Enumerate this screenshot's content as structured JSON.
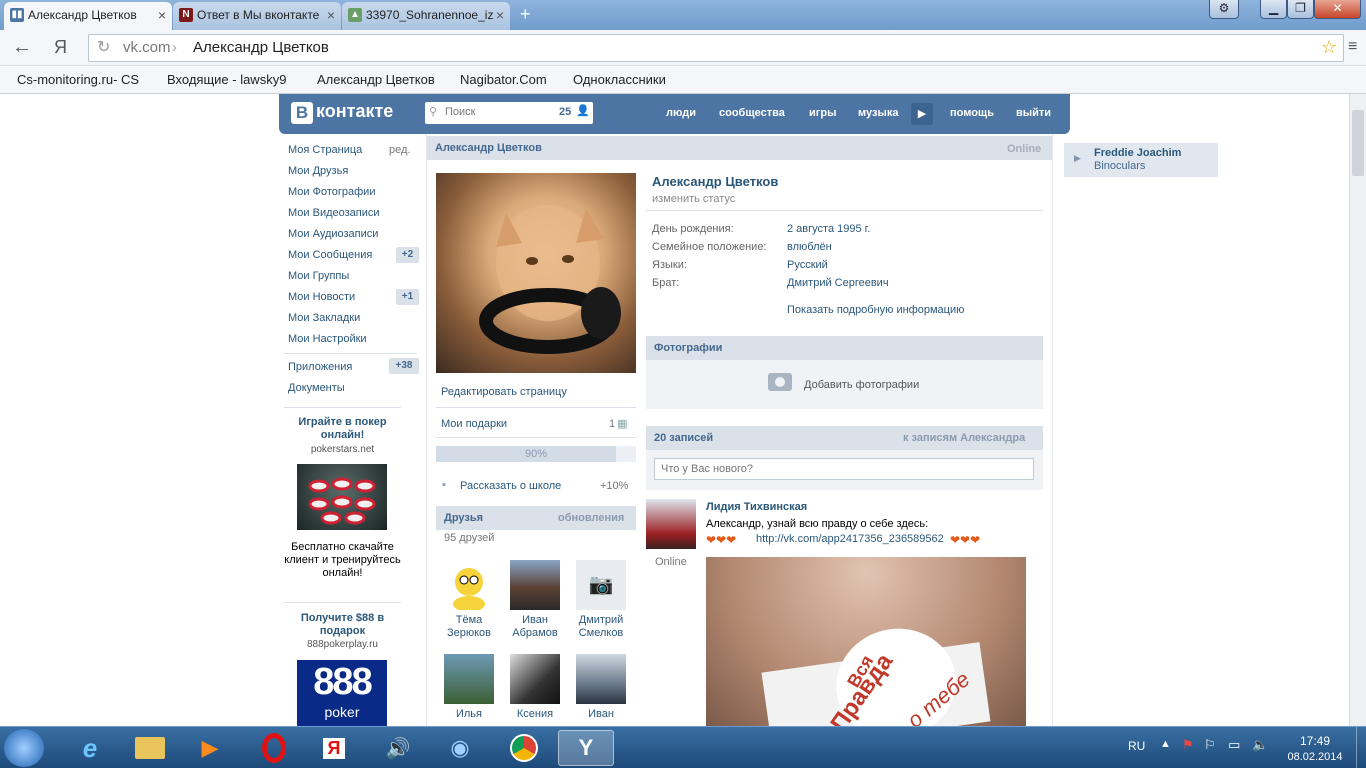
{
  "browser": {
    "tabs": [
      {
        "title": "Александр Цветков",
        "favicon": "vk-icon"
      },
      {
        "title": "Ответ в Мы вконтакте",
        "favicon": "n-icon"
      },
      {
        "title": "33970_Sohranennoe_iz",
        "favicon": "image-icon"
      }
    ],
    "address": {
      "domain": "vk.com",
      "sep": " / ",
      "path": "Александр Цветков"
    },
    "bookmarks": [
      "Cs-monitoring.ru- CS",
      "Входящие - lawsky9",
      "Александр Цветков",
      "Nagibator.Com",
      "Одноклассники"
    ]
  },
  "vk": {
    "logo_b": "B",
    "logo_text": "контакте",
    "search_placeholder": "Поиск",
    "search_count": "25",
    "nav": [
      "люди",
      "сообщества",
      "игры",
      "музыка",
      "помощь",
      "выйти"
    ],
    "left_menu": [
      {
        "label": "Моя Страница",
        "extra": "ред."
      },
      {
        "label": "Мои Друзья"
      },
      {
        "label": "Мои Фотографии"
      },
      {
        "label": "Мои Видеозаписи"
      },
      {
        "label": "Мои Аудиозаписи"
      },
      {
        "label": "Мои Сообщения",
        "count": "+2"
      },
      {
        "label": "Мои Группы"
      },
      {
        "label": "Мои Новости",
        "count": "+1"
      },
      {
        "label": "Мои Закладки"
      },
      {
        "label": "Мои Настройки"
      }
    ],
    "apps": {
      "label": "Приложения",
      "count": "+38"
    },
    "docs": "Документы",
    "ads": [
      {
        "title": "Играйте в покер онлайн!",
        "domain": "pokerstars.net",
        "text": "Бесплатно скачайте клиент и тренируйтесь онлайн!"
      },
      {
        "title": "Получите $88 в подарок",
        "domain": "888pokerplay.ru",
        "logo_text": "888",
        "logo_sub": "poker"
      }
    ],
    "profile": {
      "header_name": "Александр Цветков",
      "header_status": "Online",
      "name": "Александр Цветков",
      "change_status": "изменить статус",
      "info": [
        {
          "label": "День рождения:",
          "value": "2 августа 1995 г."
        },
        {
          "label": "Семейное положение:",
          "value": "влюблён"
        },
        {
          "label": "Языки:",
          "value": "Русский"
        },
        {
          "label": "Брат:",
          "value": "Дмитрий Сергеевич"
        }
      ],
      "show_more": "Показать подробную информацию",
      "edit_page": "Редактировать страницу",
      "gifts": {
        "label": "Мои подарки",
        "count": "1"
      },
      "progress": {
        "label": "90%",
        "value": 0.9
      },
      "school": {
        "label": "Рассказать о школе",
        "bonus": "+10%"
      },
      "photos_header": "Фотографии",
      "add_photo": "Добавить фотографии"
    },
    "friends": {
      "header": "Друзья",
      "updates": "обновления",
      "count": "95 друзей",
      "items": [
        {
          "first": "Тёма",
          "last": "Зерюков"
        },
        {
          "first": "Иван",
          "last": "Абрамов"
        },
        {
          "first": "Дмитрий",
          "last": "Смелков"
        },
        {
          "first": "Илья",
          "last": ""
        },
        {
          "first": "Ксения",
          "last": ""
        },
        {
          "first": "Иван",
          "last": ""
        }
      ]
    },
    "wall": {
      "count": "20 записей",
      "to_posts": "к записям Александра",
      "input_placeholder": "Что у Вас нового?",
      "post": {
        "author": "Лидия Тихвинская",
        "online": "Online",
        "text": "Александр, узнай всю правду о себе здесь:",
        "link": "http://vk.com/app2417356_236589562",
        "image_text1": "Вся",
        "image_text2": "Правда",
        "image_text3": "о тебе"
      }
    },
    "right_player": {
      "title": "Freddie Joachim",
      "subtitle": "Binoculars"
    }
  },
  "taskbar": {
    "lang": "RU",
    "time": "17:49",
    "date": "08.02.2014"
  },
  "colors": {
    "vk_blue": "#4c75a3",
    "link": "#2b587a",
    "header_bg": "#dae1e8"
  }
}
